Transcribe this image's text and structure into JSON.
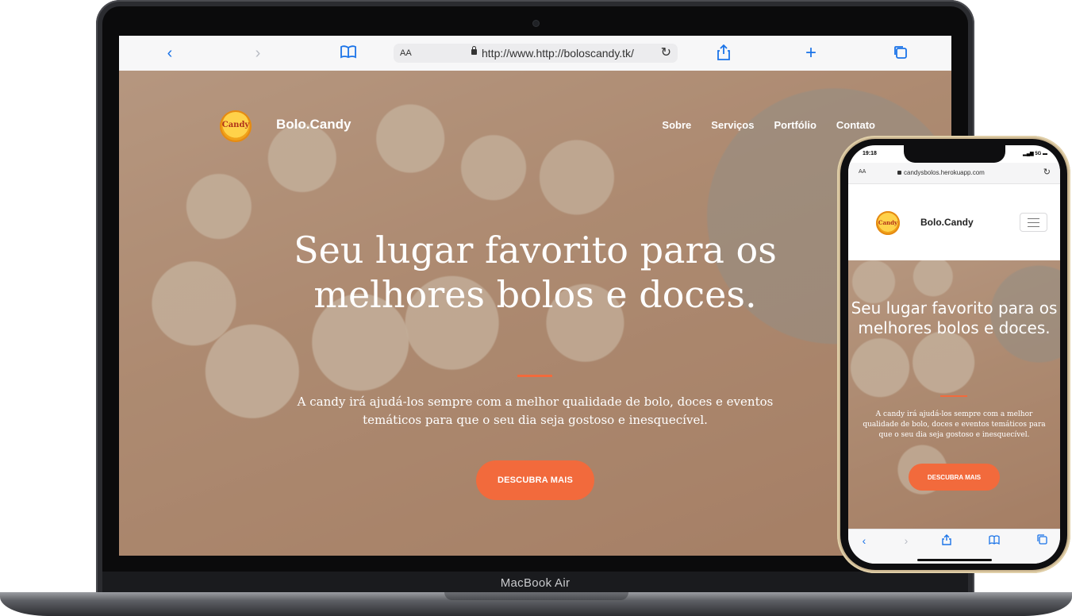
{
  "desktop": {
    "browser": {
      "url_prefix": "http://www.",
      "url_main": "http://boloscandy.tk/",
      "aa_label": "AA"
    },
    "site": {
      "logo_text": "Candy",
      "brand": "Bolo.Candy",
      "nav": [
        "Sobre",
        "Serviços",
        "Portfólio",
        "Contato"
      ],
      "headline_line1": "Seu lugar favorito para os",
      "headline_line2": "melhores bolos e doces.",
      "subtitle": "A candy irá ajudá-los sempre com a melhor qualidade de bolo, doces e eventos temáticos para que o seu dia seja gostoso e inesquecível.",
      "cta": "DESCUBRA MAIS"
    },
    "device_label": "MacBook Air"
  },
  "mobile": {
    "time": "19:18",
    "status": "5G",
    "aa_label": "AA",
    "url": "candysbolos.herokuapp.com",
    "logo_text": "Candy",
    "brand": "Bolo.Candy",
    "headline": "Seu lugar favorito para os melhores bolos e doces.",
    "subtitle": "A candy irá ajudá-los sempre com a melhor qualidade de bolo, doces e eventos temáticos para que o seu dia seja gostoso e inesquecível.",
    "cta": "DESCUBRA MAIS"
  },
  "colors": {
    "accent": "#f26a3c",
    "safari_blue": "#1a73e8"
  },
  "icons": [
    "back-icon",
    "forward-icon",
    "bookmarks-icon",
    "lock-icon",
    "reload-icon",
    "share-icon",
    "add-tab-icon",
    "tabs-icon",
    "hamburger-menu-icon"
  ]
}
